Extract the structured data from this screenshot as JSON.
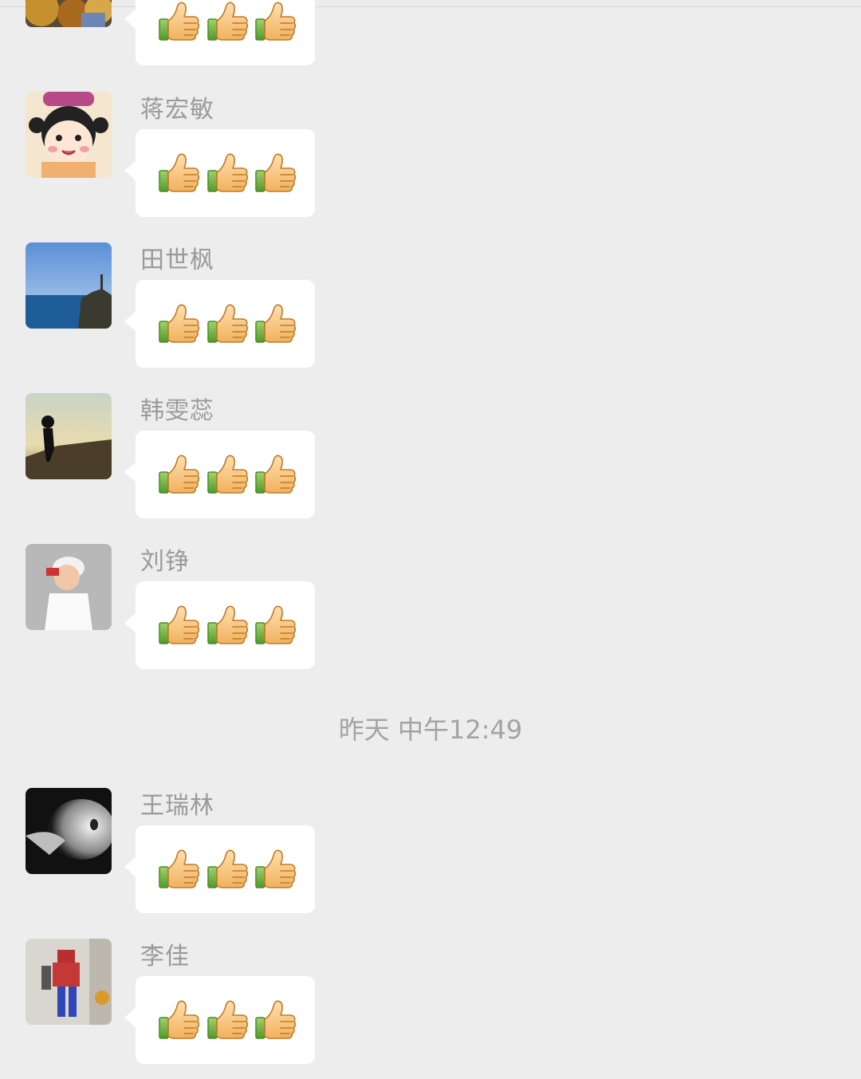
{
  "timestamp": "昨天 中午12:49",
  "reaction": {
    "icon": "thumbs-up-icon",
    "count": 3
  },
  "messages": [
    {
      "sender": "",
      "avatar": "autumn-tree-avatar"
    },
    {
      "sender": "蒋宏敏",
      "avatar": "cartoon-girl-avatar"
    },
    {
      "sender": "田世枫",
      "avatar": "seaside-cliff-avatar"
    },
    {
      "sender": "韩雯蕊",
      "avatar": "silhouette-child-avatar"
    },
    {
      "sender": "刘铮",
      "avatar": "boy-cap-avatar"
    },
    {
      "sender": "王瑞林",
      "avatar": "monochrome-cat-avatar"
    },
    {
      "sender": "李佳",
      "avatar": "robot-toy-avatar"
    }
  ]
}
